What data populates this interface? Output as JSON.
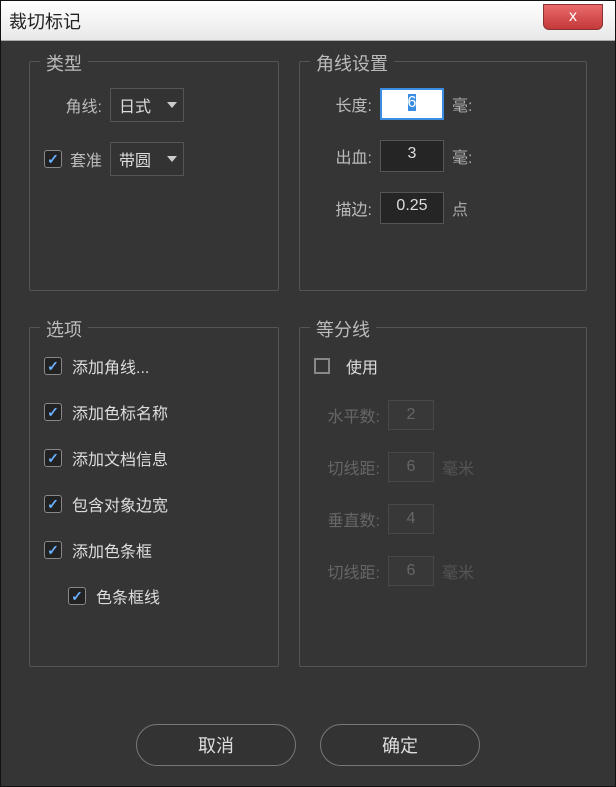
{
  "window": {
    "title": "裁切标记",
    "close_symbol": "x"
  },
  "type_group": {
    "legend": "类型",
    "angle_label": "角线:",
    "angle_value": "日式",
    "register_label": "套准",
    "register_value": "带圆"
  },
  "angle_settings": {
    "legend": "角线设置",
    "length_label": "长度:",
    "length_value": "6",
    "length_unit": "毫:",
    "bleed_label": "出血:",
    "bleed_value": "3",
    "bleed_unit": "毫:",
    "stroke_label": "描边:",
    "stroke_value": "0.25",
    "stroke_unit": "点"
  },
  "options": {
    "legend": "选项",
    "items": [
      "添加角线...",
      "添加色标名称",
      "添加文档信息",
      "包含对象边宽",
      "添加色条框",
      "色条框线"
    ]
  },
  "divider": {
    "legend": "等分线",
    "use_label": "使用",
    "rows": [
      {
        "label": "水平数:",
        "value": "2",
        "unit": ""
      },
      {
        "label": "切线距:",
        "value": "6",
        "unit": "毫米"
      },
      {
        "label": "垂直数:",
        "value": "4",
        "unit": ""
      },
      {
        "label": "切线距:",
        "value": "6",
        "unit": "毫米"
      }
    ]
  },
  "footer": {
    "cancel": "取消",
    "ok": "确定"
  }
}
